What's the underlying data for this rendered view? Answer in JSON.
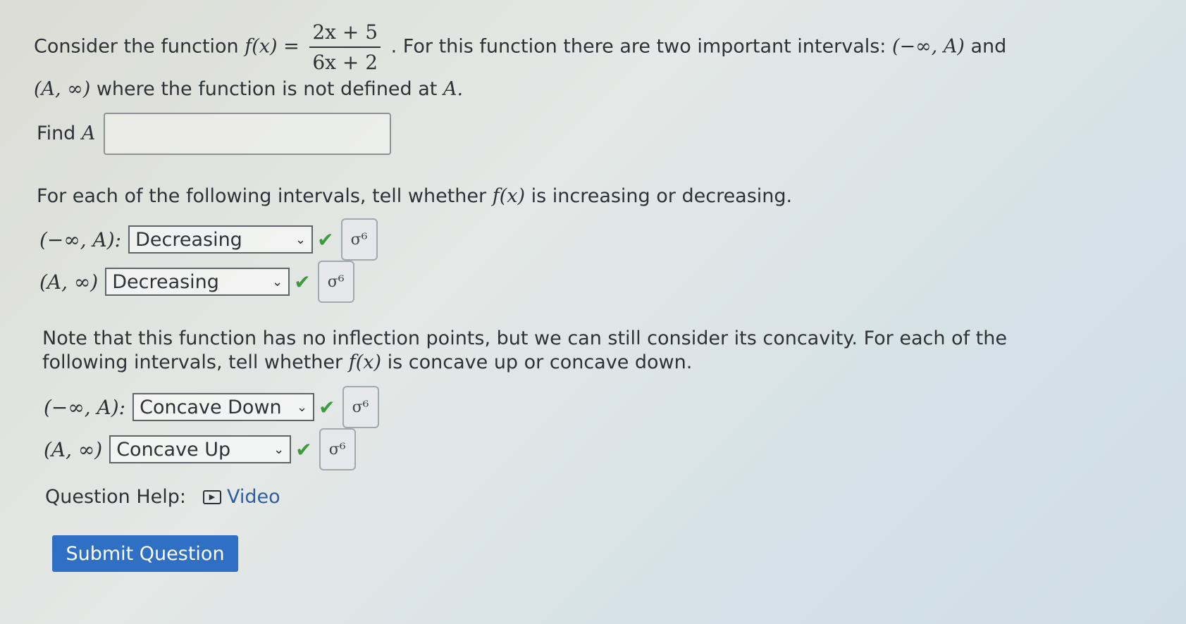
{
  "intro": {
    "prefix": "Consider the function",
    "f_of_x": "f(x) =",
    "numerator": "2x + 5",
    "denominator": "6x + 2",
    "middle": ". For this function there are two important intervals:",
    "interval_1": "(−∞, A)",
    "and": "and",
    "interval_2": "(A, ∞)",
    "suffix": "where the function is not defined at",
    "A_end": "A."
  },
  "find": {
    "label": "Find",
    "var": "A",
    "value": "",
    "placeholder": ""
  },
  "increasing": {
    "instruction_pre": "For each of the following intervals, tell whether",
    "fx": "f(x)",
    "instruction_post": "is increasing or decreasing.",
    "rows": [
      {
        "interval": "(−∞, A):",
        "selected": "Decreasing"
      },
      {
        "interval": "(A, ∞)",
        "selected": "Decreasing"
      }
    ]
  },
  "concavity": {
    "line1": "Note that this function has no inflection points, but we can still consider its concavity. For each of the",
    "line2_pre": "following intervals, tell whether",
    "fx": "f(x)",
    "line2_post": "is concave up or concave down.",
    "rows": [
      {
        "interval": "(−∞, A):",
        "selected": "Concave Down"
      },
      {
        "interval": "(A, ∞)",
        "selected": "Concave Up"
      }
    ]
  },
  "icons": {
    "check": "✔",
    "chevron": "⌄",
    "graph_button": "σ⁶",
    "video": "▶"
  },
  "help": {
    "label": "Question Help:",
    "video": "Video"
  },
  "submit": {
    "label": "Submit Question"
  },
  "colors": {
    "submit_bg": "#2f6fc4",
    "check": "#3d9a3d",
    "link": "#2f5e9e"
  }
}
